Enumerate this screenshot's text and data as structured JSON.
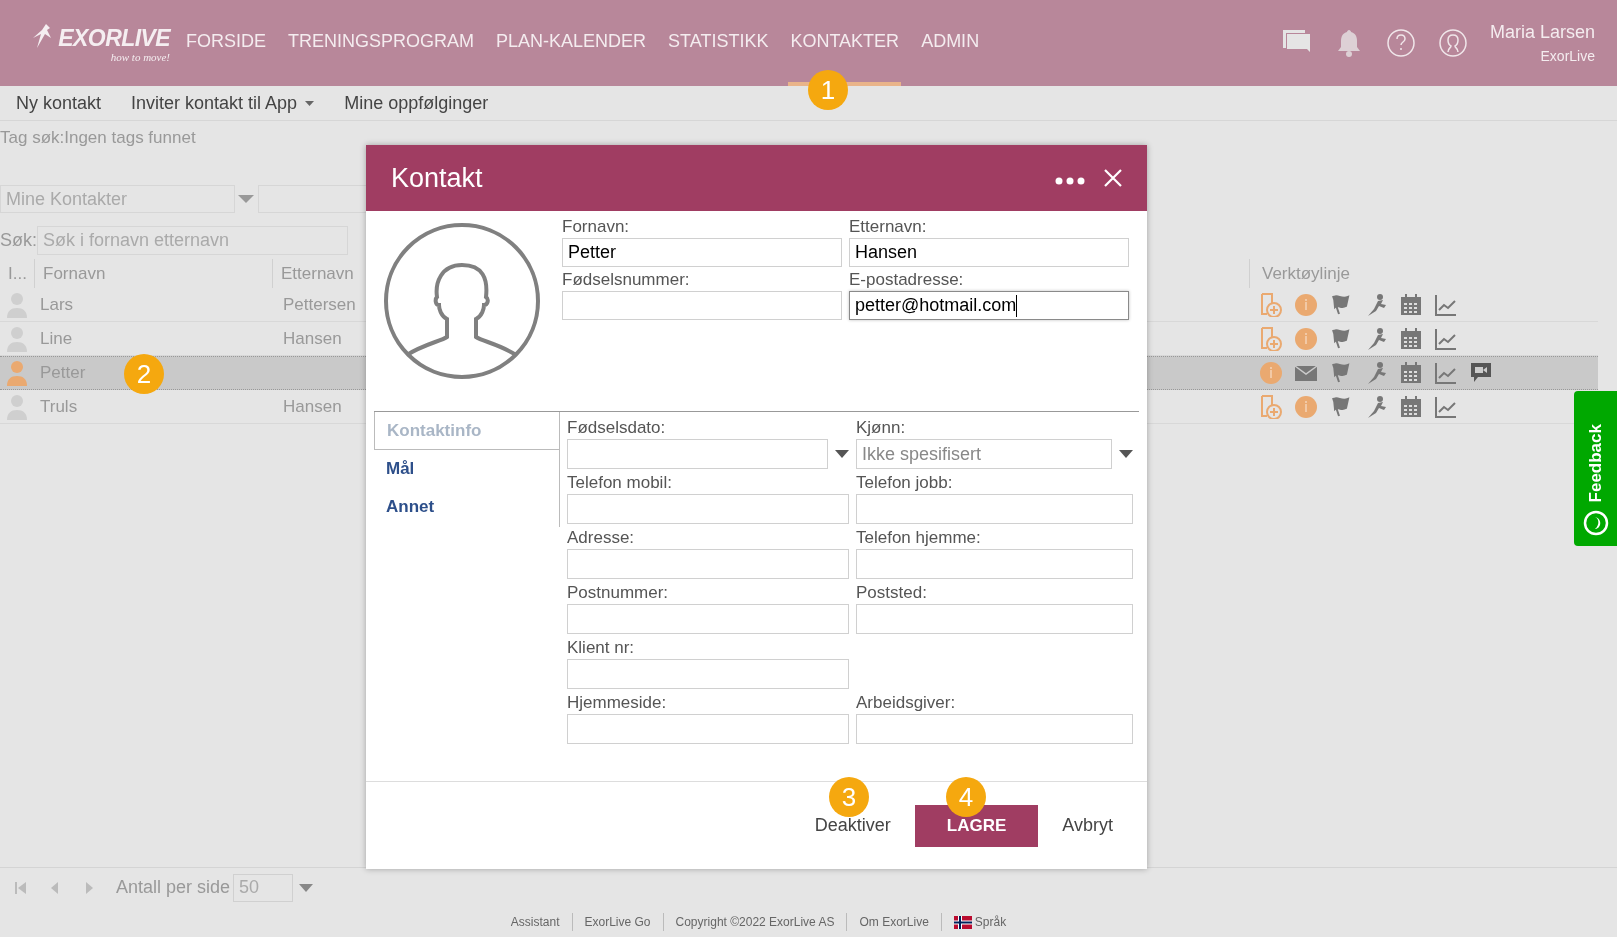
{
  "header": {
    "logo": {
      "wordmark": "EXORLIVE",
      "tagline": "how to move!"
    },
    "nav": [
      {
        "label": "FORSIDE",
        "selected": false
      },
      {
        "label": "TRENINGSPROGRAM",
        "selected": false
      },
      {
        "label": "PLAN-KALENDER",
        "selected": false
      },
      {
        "label": "STATISTIKK",
        "selected": false
      },
      {
        "label": "KONTAKTER",
        "selected": true
      },
      {
        "label": "ADMIN",
        "selected": false
      }
    ],
    "user": {
      "name": "Maria Larsen",
      "org": "ExorLive"
    }
  },
  "subnav": [
    {
      "label": "Ny kontakt",
      "kind": "link"
    },
    {
      "label": "Inviter kontakt til App",
      "kind": "dropdown"
    },
    {
      "label": "Mine oppfølginger",
      "kind": "link"
    }
  ],
  "tag_search": "Tag søk:Ingen tags funnet",
  "filter": {
    "value": "Mine Kontakter"
  },
  "search": {
    "label": "Søk:",
    "placeholder": "Søk i fornavn etternavn"
  },
  "table": {
    "columns": [
      "I...",
      "Fornavn",
      "Etternavn",
      "Verktøylinje"
    ],
    "rows": [
      {
        "first_name": "Lars",
        "last_name": "Pettersen",
        "selected": false
      },
      {
        "first_name": "Line",
        "last_name": "Hansen",
        "selected": false
      },
      {
        "first_name": "Petter",
        "selected": true
      },
      {
        "first_name": "Truls",
        "last_name": "Hansen",
        "selected": false
      }
    ]
  },
  "pager": {
    "label": "Antall per side",
    "per_page": "50"
  },
  "footer": [
    {
      "label": "Assistant",
      "kind": "link"
    },
    {
      "label": "ExorLive Go",
      "kind": "link"
    },
    {
      "label": "Copyright ©2022 ExorLive AS",
      "kind": "text"
    },
    {
      "label": "Om ExorLive",
      "kind": "link"
    },
    {
      "label": "Språk",
      "kind": "language"
    }
  ],
  "dialog": {
    "title": "Kontakt",
    "top_fields": [
      {
        "label": "Fornavn:",
        "value": "Petter",
        "focused": false
      },
      {
        "label": "Etternavn:",
        "value": "Hansen",
        "focused": false
      },
      {
        "label": "Fødselsnummer:",
        "focused": false
      },
      {
        "label": "E-postadresse:",
        "value": "petter@hotmail.com",
        "focused": true
      }
    ],
    "tabs": [
      {
        "label": "Kontaktinfo",
        "selected": true
      },
      {
        "label": "Mål",
        "selected": false
      },
      {
        "label": "Annet",
        "selected": false
      }
    ],
    "rows": [
      [
        {
          "label": "Fødselsdato:",
          "kind": "select"
        },
        {
          "label": "Kjønn:",
          "kind": "select",
          "value": "Ikke spesifisert"
        }
      ],
      [
        {
          "label": "Telefon mobil:",
          "kind": "text"
        },
        {
          "label": "Telefon jobb:",
          "kind": "text"
        }
      ],
      [
        {
          "label": "Adresse:",
          "kind": "text"
        },
        {
          "label": "Telefon hjemme:",
          "kind": "text"
        }
      ],
      [
        {
          "label": "Postnummer:",
          "kind": "text"
        },
        {
          "label": "Poststed:",
          "kind": "text"
        }
      ],
      [
        {
          "label": "Klient nr:",
          "kind": "text"
        }
      ],
      [
        {
          "label": "Hjemmeside:",
          "kind": "text"
        },
        {
          "label": "Arbeidsgiver:",
          "kind": "text"
        }
      ]
    ],
    "buttons": [
      {
        "label": "Deaktiver",
        "kind": "plain"
      },
      {
        "label": "LAGRE",
        "kind": "primary"
      },
      {
        "label": "Avbryt",
        "kind": "plain"
      }
    ]
  },
  "feedback": {
    "label": "Feedback"
  },
  "annotations": [
    "1",
    "2",
    "3",
    "4"
  ]
}
